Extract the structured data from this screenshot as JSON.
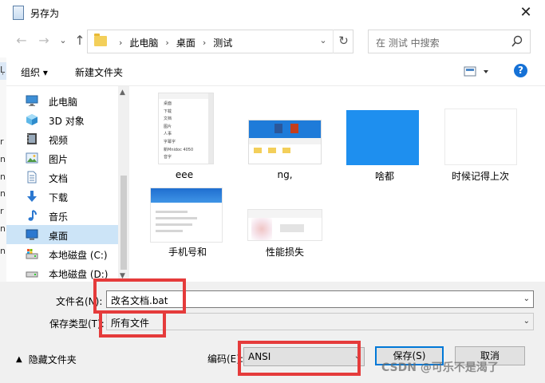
{
  "window": {
    "title": "另存为",
    "close_symbol": "✕"
  },
  "address_bar": {
    "back_symbol": "←",
    "forward_symbol": "→",
    "recent_symbol": "⌄",
    "up_symbol": "↑",
    "crumbs": [
      "此电脑",
      "桌面",
      "测试"
    ],
    "sep_symbol": "›",
    "dropdown_symbol": "⌄",
    "refresh_symbol": "↻"
  },
  "search": {
    "placeholder": "在 测试 中搜索"
  },
  "toolbar": {
    "organize_label": "组织 ▾",
    "new_folder_label": "新建文件夹",
    "help_symbol": "?"
  },
  "left_strip_chars": [
    "Ļ",
    "r",
    "n",
    "n",
    "n",
    "r",
    "n",
    "n"
  ],
  "nav": {
    "items": [
      {
        "label": "此电脑",
        "icon": "computer-icon"
      },
      {
        "label": "3D 对象",
        "icon": "3d-objects-icon"
      },
      {
        "label": "视频",
        "icon": "video-icon"
      },
      {
        "label": "图片",
        "icon": "pictures-icon"
      },
      {
        "label": "文档",
        "icon": "documents-icon"
      },
      {
        "label": "下载",
        "icon": "download-icon"
      },
      {
        "label": "音乐",
        "icon": "music-icon"
      },
      {
        "label": "桌面",
        "icon": "desktop-icon",
        "selected": true
      },
      {
        "label": "本地磁盘 (C:)",
        "icon": "drive-c-icon"
      },
      {
        "label": "本地磁盘 (D:)",
        "icon": "drive-d-icon"
      }
    ]
  },
  "files": [
    {
      "name": "eee"
    },
    {
      "name": "ng,"
    },
    {
      "name": "啥都"
    },
    {
      "name": "时候记得上次"
    },
    {
      "name": "手机号和"
    },
    {
      "name": "性能损失"
    }
  ],
  "thumb_texts": {
    "eee_lines": [
      "桌面",
      "下载",
      "文档",
      "图片",
      "人事",
      "字幕字",
      "新Mnidoc 4050",
      "音字"
    ]
  },
  "form": {
    "filename_label": "文件名(N):",
    "filename_value": "改名文档.bat",
    "filetype_label": "保存类型(T):",
    "filetype_value": "所有文件",
    "encoding_label": "编码(E):",
    "encoding_value": "ANSI",
    "save_label": "保存(S)",
    "cancel_label": "取消",
    "hide_folders_label": "隐藏文件夹",
    "dropdown_symbol": "⌄"
  },
  "watermark": "CSDN @可乐不是渴了",
  "colors": {
    "accent": "#0078d7",
    "highlight": "#e53b3b",
    "selected": "#cce4f7"
  }
}
